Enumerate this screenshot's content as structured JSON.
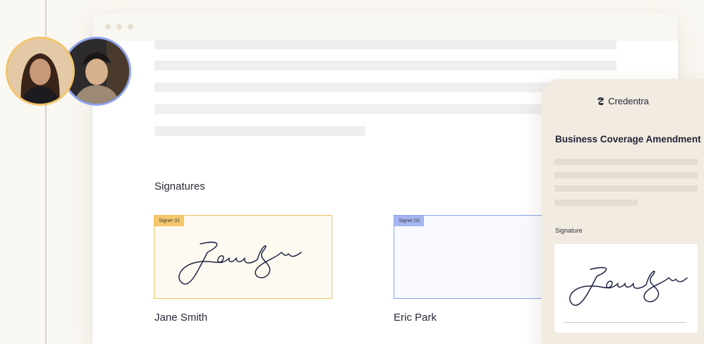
{
  "signatures_heading": "Signatures",
  "signers": [
    {
      "tag": "Signer 01",
      "name": "Jane Smith",
      "accent": "#f0c25c"
    },
    {
      "tag": "Signer 02",
      "name": "Eric Park",
      "accent": "#8aa0ea"
    }
  ],
  "mobile": {
    "brand": "Credentra",
    "document_title": "Business Coverage Amendment",
    "signature_label": "Signature"
  }
}
